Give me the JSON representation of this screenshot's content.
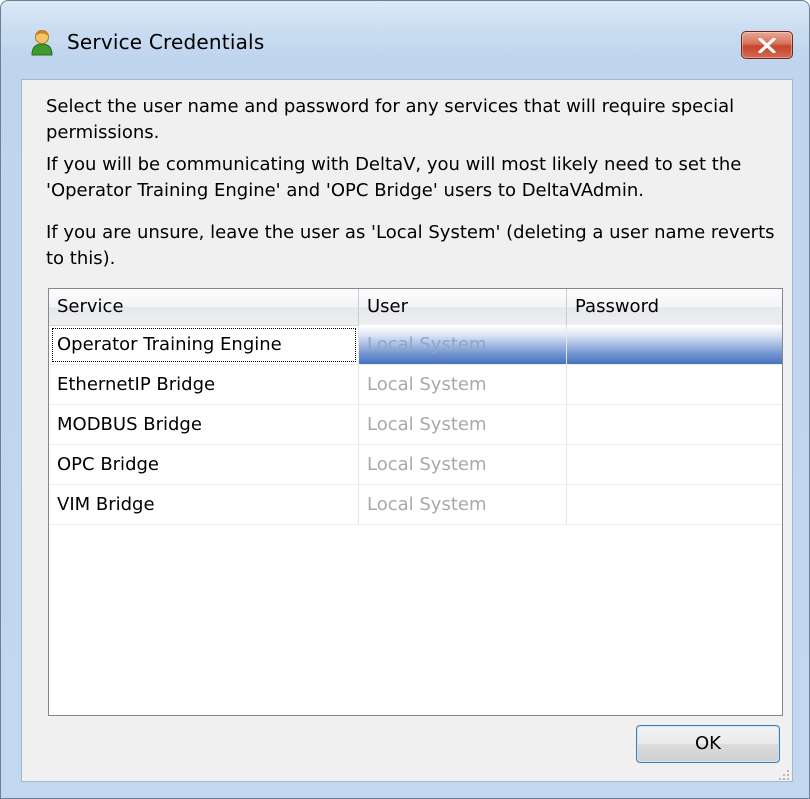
{
  "window": {
    "title": "Service Credentials",
    "icon": "user-icon"
  },
  "instructions": {
    "line1": "Select the user name and password for any services that will require special permissions.",
    "line2": "If you will be communicating with DeltaV, you will most likely need to set the 'Operator Training Engine' and 'OPC Bridge' users to DeltaVAdmin.",
    "line3": "If you are unsure, leave the user as 'Local System' (deleting a user name reverts to this)."
  },
  "table": {
    "columns": [
      "Service",
      "User",
      "Password"
    ],
    "rows": [
      {
        "service": "Operator Training Engine",
        "user": "Local System",
        "password": ""
      },
      {
        "service": "EthernetIP Bridge",
        "user": "Local System",
        "password": ""
      },
      {
        "service": "MODBUS Bridge",
        "user": "Local System",
        "password": ""
      },
      {
        "service": "OPC Bridge",
        "user": "Local System",
        "password": ""
      },
      {
        "service": "VIM Bridge",
        "user": "Local System",
        "password": ""
      }
    ],
    "selected_row": 0
  },
  "buttons": {
    "ok_label": "OK"
  },
  "colors": {
    "selection": "#4872bf",
    "close_button": "#c4452e",
    "placeholder_text": "#a9a9a9"
  }
}
